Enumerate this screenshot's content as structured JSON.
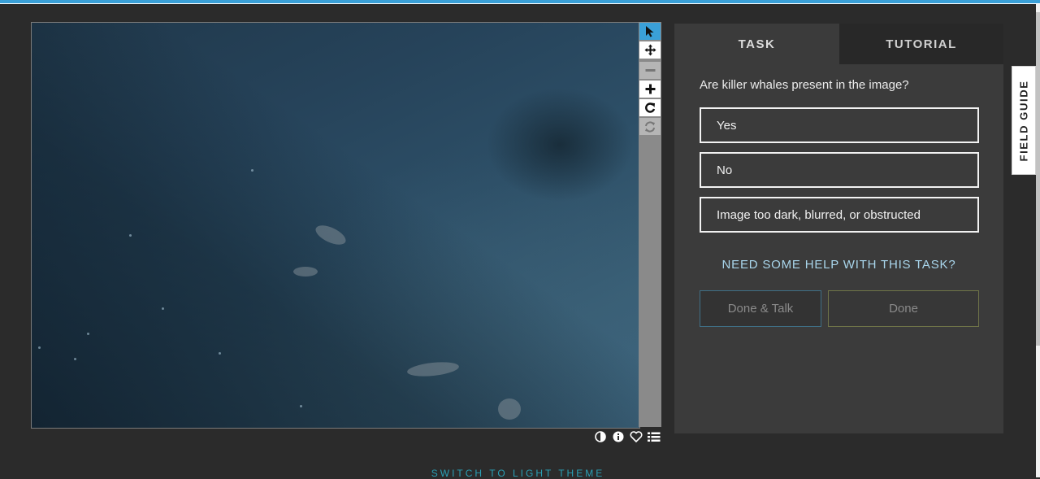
{
  "toolbar": {
    "tools": [
      "pointer-icon",
      "move-icon",
      "zoom-out-icon",
      "zoom-in-icon",
      "rotate-icon",
      "reset-icon"
    ]
  },
  "meta_icons": [
    "contrast-icon",
    "info-icon",
    "heart-icon",
    "list-icon"
  ],
  "tabs": {
    "task": "TASK",
    "tutorial": "TUTORIAL"
  },
  "task": {
    "question": "Are killer whales present in the image?",
    "answers": [
      "Yes",
      "No",
      "Image too dark, blurred, or obstructed"
    ],
    "help_link": "NEED SOME HELP WITH THIS TASK?",
    "done_talk": "Done & Talk",
    "done": "Done"
  },
  "field_guide": "FIELD GUIDE",
  "theme_switch": "SWITCH TO LIGHT THEME",
  "colors": {
    "accent_blue": "#3aa0d8",
    "link": "#a9d6ec",
    "background": "#2b2b2b",
    "panel": "#3b3b3b"
  }
}
